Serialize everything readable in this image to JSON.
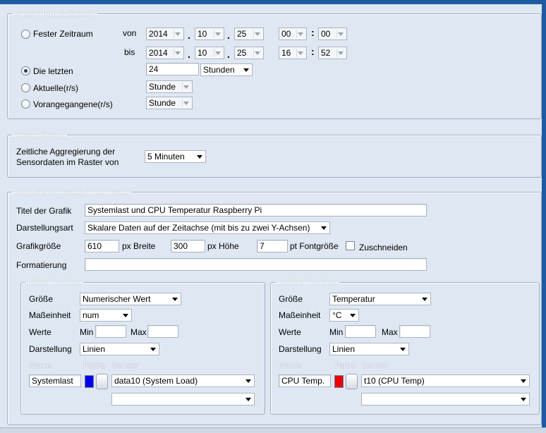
{
  "auswertungszeitraum": {
    "legend": "Auswertungszeitraum",
    "fester": {
      "label": "Fester Zeitraum",
      "selected": false
    },
    "von_label": "von",
    "bis_label": "bis",
    "von": {
      "year": "2014",
      "month": "10",
      "day": "25",
      "hour": "00",
      "minute": "00"
    },
    "bis": {
      "year": "2014",
      "month": "10",
      "day": "25",
      "hour": "16",
      "minute": "52"
    },
    "date_sep": ".",
    "time_sep": ":",
    "letzten": {
      "label": "Die letzten",
      "selected": true,
      "value": "24",
      "unit": "Stunden"
    },
    "aktuelle": {
      "label": "Aktuelle(r/s)",
      "selected": false,
      "unit": "Stunde"
    },
    "vorangegangene": {
      "label": "Vorangegangene(r/s)",
      "selected": false,
      "unit": "Stunde"
    }
  },
  "zeitaufloesung": {
    "legend": "Zeitauflösung",
    "label_line1": "Zeitliche Aggregierung der",
    "label_line2": "Sensordaten im Raster von",
    "value": "5 Minuten"
  },
  "grafik": {
    "legend": "Graphische Anzeige der Daten",
    "titel_label": "Titel der Grafik",
    "titel_value": "Systemlast und CPU Temperatur Raspberry Pi",
    "darstellungsart_label": "Darstellungsart",
    "darstellungsart_value": "Skalare Daten auf der Zeitachse (mit bis zu zwei Y-Achsen)",
    "groesse_label": "Grafikgröße",
    "breite_value": "610",
    "breite_unit": "px Breite",
    "hoehe_value": "300",
    "hoehe_unit": "px Höhe",
    "font_value": "7",
    "font_unit": "pt Fontgröße",
    "zuschneiden_label": "Zuschneiden",
    "formatierung_label": "Formatierung",
    "formatierung_value": ""
  },
  "linke": {
    "legend": "Linke Y-Achse",
    "groesse_label": "Größe",
    "groesse_value": "Numerischer Wert",
    "masseinheit_label": "Maßeinheit",
    "masseinheit_value": "num",
    "werte_label": "Werte",
    "min_label": "Min",
    "max_label": "Max",
    "min_value": "",
    "max_value": "",
    "darstellung_label": "Darstellung",
    "darstellung_value": "Linien",
    "name_header": "Name",
    "farbe_header": "Farbe",
    "sensor_header": "Sensor",
    "name_value": "Systemlast",
    "color": "#0000ee",
    "sensor_value": "data10 (System Load)",
    "sensor2_value": ""
  },
  "rechte": {
    "legend": "Rechte Y-Achse",
    "groesse_label": "Größe",
    "groesse_value": "Temperatur",
    "masseinheit_label": "Maßeinheit",
    "masseinheit_value": "°C",
    "werte_label": "Werte",
    "min_label": "Min",
    "max_label": "Max",
    "min_value": "",
    "max_value": "",
    "darstellung_label": "Darstellung",
    "darstellung_value": "Linien",
    "name_header": "Name",
    "farbe_header": "Farbe",
    "sensor_header": "Sensor",
    "name_value": "CPU Temp.",
    "color": "#ee0000",
    "sensor_value": "t10 (CPU Temp)",
    "sensor2_value": ""
  }
}
